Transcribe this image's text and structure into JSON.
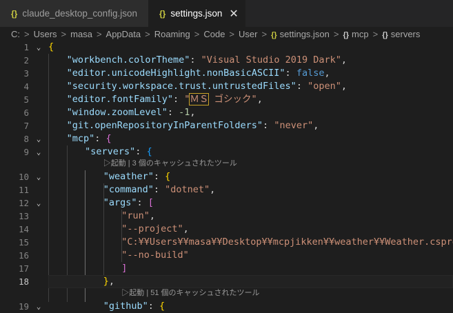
{
  "tabs": [
    {
      "icon": "{}",
      "label": "claude_desktop_config.json",
      "active": false
    },
    {
      "icon": "{}",
      "label": "settings.json",
      "active": true,
      "close": "✕"
    }
  ],
  "breadcrumb": {
    "parts": [
      "C:",
      "Users",
      "masa",
      "AppData",
      "Roaming",
      "Code",
      "User"
    ],
    "file": "settings.json",
    "symbols": [
      "mcp",
      "servers"
    ],
    "separator": ">",
    "file_icon": "{}",
    "symbol_icon": "{}"
  },
  "editor": {
    "current_line": 18,
    "lines": [
      {
        "n": "1",
        "fold": "⌄",
        "text": "{"
      },
      {
        "n": "2",
        "text": "\"workbench.colorTheme\": \"Visual Studio 2019 Dark\","
      },
      {
        "n": "3",
        "text": "\"editor.unicodeHighlight.nonBasicASCII\": false,"
      },
      {
        "n": "4",
        "text": "\"security.workspace.trust.untrustedFiles\": \"open\","
      },
      {
        "n": "5",
        "text": "\"editor.fontFamily\": \"ＭＳ ゴシック\","
      },
      {
        "n": "6",
        "text": "\"window.zoomLevel\": -1,"
      },
      {
        "n": "7",
        "text": "\"git.openRepositoryInParentFolders\": \"never\","
      },
      {
        "n": "8",
        "fold": "⌄",
        "text": "\"mcp\": {"
      },
      {
        "n": "9",
        "fold": "⌄",
        "text": "\"servers\": {"
      },
      {
        "n": "10",
        "fold": "⌄",
        "text": "\"weather\": {"
      },
      {
        "n": "11",
        "text": "\"command\": \"dotnet\","
      },
      {
        "n": "12",
        "fold": "⌄",
        "text": "\"args\": ["
      },
      {
        "n": "13",
        "text": "\"run\","
      },
      {
        "n": "14",
        "text": "\"--project\","
      },
      {
        "n": "15",
        "text": "\"C:¥¥Users¥¥masa¥¥Desktop¥¥mcpjikken¥¥weather¥¥Weather.csproj\","
      },
      {
        "n": "16",
        "text": "\"--no-build\""
      },
      {
        "n": "17",
        "text": "]"
      },
      {
        "n": "18",
        "text": "},"
      },
      {
        "n": "19",
        "fold": "⌄",
        "text": "\"github\": {"
      }
    ],
    "codelens": [
      {
        "after_line": "9",
        "text": "▷起動 | 3 個のキャッシュされたツール"
      },
      {
        "after_line": "18",
        "text": "▷起動 | 51 個のキャッシュされたツール"
      }
    ]
  },
  "colors": {
    "key": "#9cdcfe",
    "string": "#ce9178",
    "number": "#b5cea8",
    "boolean": "#569cd6",
    "bracket_gold": "#ffd700",
    "bracket_purple": "#da70d6",
    "bracket_blue": "#179fff",
    "file_icon": "#cbcb41"
  }
}
